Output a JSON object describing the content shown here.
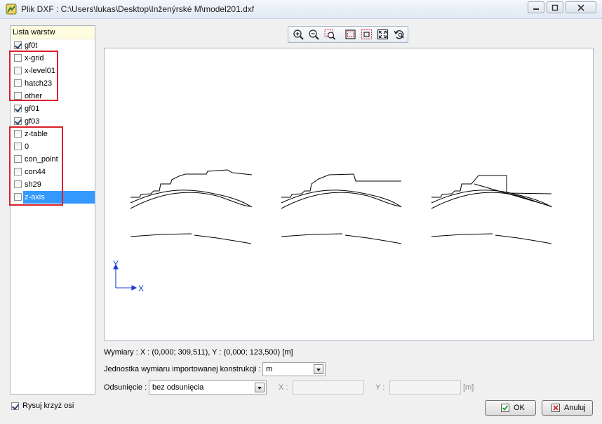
{
  "window": {
    "title": "Plik DXF : C:\\Users\\lukas\\Desktop\\Inženýrské M\\model201.dxf"
  },
  "layers": {
    "header": "Lista warstw",
    "items": [
      {
        "label": "gf0t",
        "checked": true
      },
      {
        "label": "x-grid",
        "checked": false
      },
      {
        "label": "x-level01",
        "checked": false
      },
      {
        "label": "hatch23",
        "checked": false
      },
      {
        "label": "other",
        "checked": false
      },
      {
        "label": "gf01",
        "checked": true
      },
      {
        "label": "gf03",
        "checked": true
      },
      {
        "label": "z-table",
        "checked": false
      },
      {
        "label": "0",
        "checked": false
      },
      {
        "label": "con_point",
        "checked": false
      },
      {
        "label": "con44",
        "checked": false
      },
      {
        "label": "sh29",
        "checked": false
      },
      {
        "label": "z-axis",
        "checked": false,
        "selected": true
      }
    ]
  },
  "toolbar": {
    "tools": [
      "zoom-in-icon",
      "zoom-out-icon",
      "zoom-window-icon",
      "select-region-icon",
      "fit-selection-icon",
      "zoom-extents-icon",
      "rotate-view-icon"
    ]
  },
  "axes": {
    "y": "Y",
    "x": "X"
  },
  "info": {
    "dimensions": "Wymiary : X : (0,000; 309,511), Y : (0,000; 123,500) [m]"
  },
  "unit": {
    "label": "Jednostka wymiaru importowanej konstrukcji :",
    "value": "m"
  },
  "offset": {
    "label": "Odsunięcie :",
    "value": "bez odsunięcia",
    "x_label": "X :",
    "y_label": "Y :",
    "unit": "[m]"
  },
  "crosshair": {
    "label": "Rysuj krzyż osi",
    "checked": true
  },
  "buttons": {
    "ok": "OK",
    "cancel": "Anuluj"
  },
  "colors": {
    "selection": "#3399ff",
    "highlight_frame": "#d9202b",
    "ok_icon": "#1a9a2a",
    "cancel_icon": "#d01818"
  }
}
